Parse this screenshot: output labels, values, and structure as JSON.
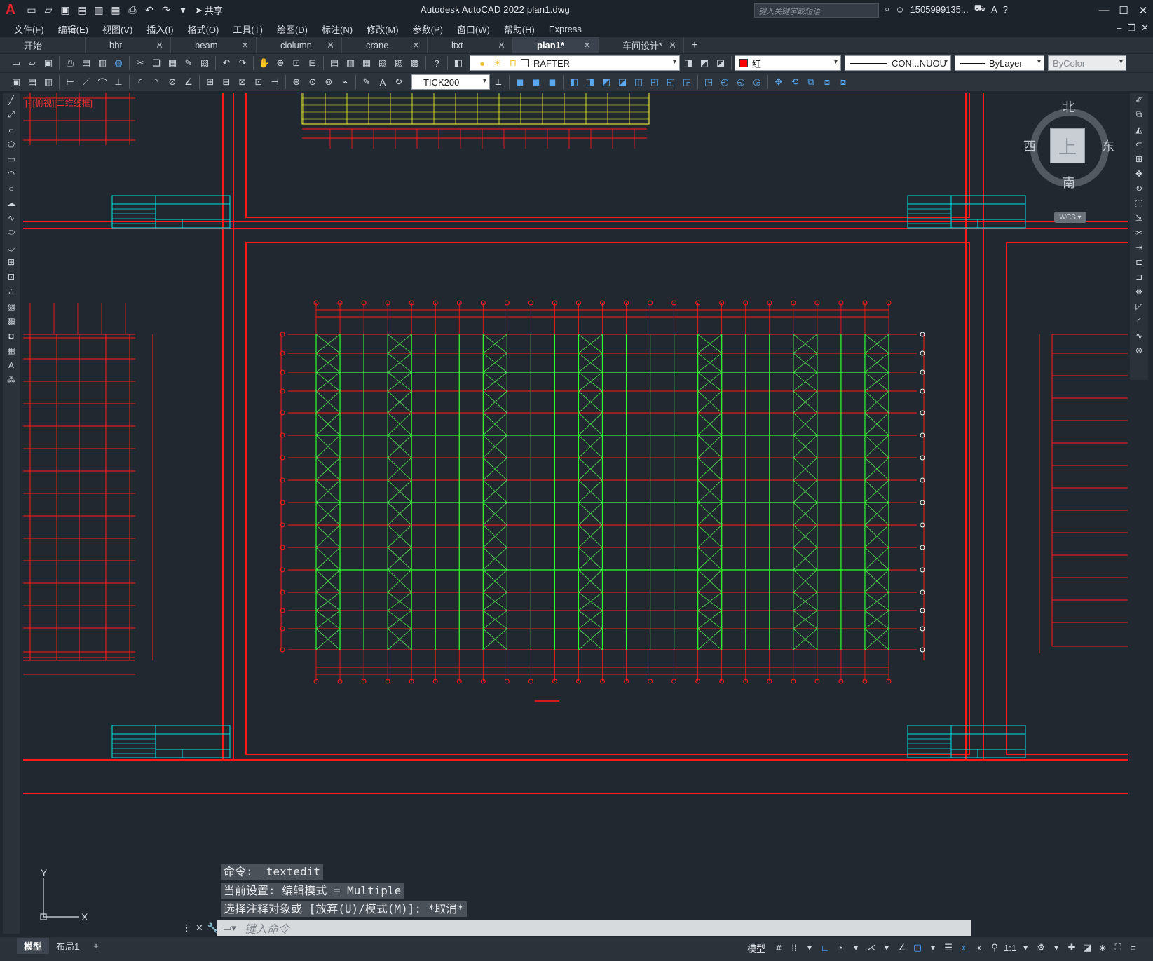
{
  "titlebar": {
    "app_title": "Autodesk AutoCAD 2022    plan1.dwg",
    "share_label": "共享",
    "search_placeholder": "键入关键字或短语",
    "user_name": "1505999135...",
    "quick_access_icons": [
      "new-icon",
      "open-icon",
      "save-icon",
      "save-as-icon",
      "plot-preview-icon",
      "export-icon",
      "print-icon",
      "undo-icon",
      "redo-icon"
    ]
  },
  "menubar": {
    "items": [
      "文件(F)",
      "编辑(E)",
      "视图(V)",
      "插入(I)",
      "格式(O)",
      "工具(T)",
      "绘图(D)",
      "标注(N)",
      "修改(M)",
      "参数(P)",
      "窗口(W)",
      "帮助(H)",
      "Express"
    ]
  },
  "filetabs": {
    "tabs": [
      {
        "label": "开始",
        "active": false
      },
      {
        "label": "bbt",
        "active": false
      },
      {
        "label": "beam",
        "active": false
      },
      {
        "label": "clolumn",
        "active": false
      },
      {
        "label": "crane",
        "active": false
      },
      {
        "label": "ltxt",
        "active": false
      },
      {
        "label": "plan1*",
        "active": true
      },
      {
        "label": "车间设计*",
        "active": false
      }
    ],
    "close_glyph": "✕",
    "add_glyph": "+"
  },
  "properties": {
    "layer": "RAFTER",
    "color_name": "红",
    "color_hex": "#ff0000",
    "linetype": "CON...NUOU",
    "lineweight": "ByLayer",
    "plotstyle": "ByColor",
    "dimstyle": "TICK200"
  },
  "viewport": {
    "view_label": "[-][俯视][二维线框]"
  },
  "viewcube": {
    "north": "北",
    "south": "南",
    "east": "东",
    "west": "西",
    "face": "上",
    "wcs": "WCS"
  },
  "command": {
    "history": [
      "命令: _textedit",
      "当前设置: 编辑模式 = Multiple",
      "选择注释对象或 [放弃(U)/模式(M)]: *取消*"
    ],
    "placeholder": "键入命令"
  },
  "ucs": {
    "x_label": "X",
    "y_label": "Y"
  },
  "statusbar": {
    "layout_tabs": [
      {
        "label": "模型",
        "active": true
      },
      {
        "label": "布局1",
        "active": false
      }
    ],
    "add_glyph": "+",
    "model_label": "模型",
    "scale": "1:1"
  },
  "colors": {
    "background": "#212830",
    "frame_red": "#ff1a1a",
    "grid_red": "#e01818",
    "column_green": "#33ff33",
    "bracing_green": "#4ad14a",
    "title_cyan": "#00e6e6",
    "label_yellow": "#ffff33"
  }
}
